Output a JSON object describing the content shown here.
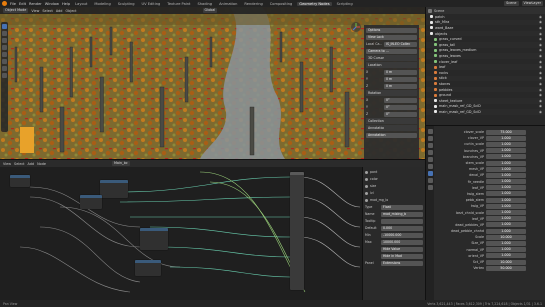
{
  "topbar": {
    "menus": [
      "File",
      "Edit",
      "Render",
      "Window",
      "Help"
    ],
    "workspaces": [
      "Layout",
      "Modeling",
      "Sculpting",
      "UV Editing",
      "Texture Paint",
      "Shading",
      "Animation",
      "Rendering",
      "Compositing",
      "Geometry Nodes",
      "Scripting"
    ],
    "active_workspace": "Geometry Nodes",
    "scene": "Scene",
    "view_layer": "ViewLayer"
  },
  "viewport": {
    "mode": "Object Mode",
    "menus": [
      "View",
      "Select",
      "Add",
      "Object"
    ],
    "transform": "Global",
    "npanel": {
      "rows": [
        {
          "label": "",
          "value": "Options"
        },
        {
          "label": "",
          "value": "View Lock"
        },
        {
          "label": "Local Ca…",
          "value": "IS_IN-EO Collec"
        },
        {
          "label": "",
          "value": "Camera to …"
        },
        {
          "label": "3D Cursor",
          "value": ""
        },
        {
          "label": "Location",
          "value": ""
        },
        {
          "label": "X",
          "value": "0 m"
        },
        {
          "label": "Y",
          "value": "0 m"
        },
        {
          "label": "Z",
          "value": "0 m"
        },
        {
          "label": "Rotation",
          "value": ""
        },
        {
          "label": "X",
          "value": "0°"
        },
        {
          "label": "Y",
          "value": "0°"
        },
        {
          "label": "Z",
          "value": "0°"
        },
        {
          "label": "Collections",
          "value": ""
        },
        {
          "label": "Annotations",
          "value": ""
        },
        {
          "label": "",
          "value": "Annotation"
        }
      ]
    }
  },
  "outliner": {
    "title": "Scene",
    "items": [
      {
        "name": "patch",
        "color": "#e8e8e8"
      },
      {
        "name": "sth_Mira",
        "color": "#e8e8e8"
      },
      {
        "name": "ward_Baze",
        "color": "#e8e8e8"
      },
      {
        "name": "objects",
        "color": "#e8e8e8"
      },
      {
        "name": "grass_curved",
        "color": "#83c37a"
      },
      {
        "name": "grass_tall",
        "color": "#83c37a"
      },
      {
        "name": "grass_leaves_medium",
        "color": "#83c37a"
      },
      {
        "name": "grass_leaves",
        "color": "#83c37a"
      },
      {
        "name": "clover_leaf",
        "color": "#83c37a"
      },
      {
        "name": "leaf",
        "color": "#d97b3b"
      },
      {
        "name": "rocks",
        "color": "#d97b3b"
      },
      {
        "name": "stick",
        "color": "#d97b3b"
      },
      {
        "name": "stones",
        "color": "#d97b3b"
      },
      {
        "name": "pebbles",
        "color": "#d97b3b"
      },
      {
        "name": "ground",
        "color": "#d97b3b"
      },
      {
        "name": "sheet_texture",
        "color": "#e8e8e8"
      },
      {
        "name": "main_mask_ref_GD_SciD",
        "color": "#e8e8e8"
      },
      {
        "name": "main_mask_ref_GD_SciD",
        "color": "#e8e8e8"
      }
    ]
  },
  "properties": {
    "rows": [
      {
        "label": "clover_scale",
        "value": "75.000"
      },
      {
        "label": "clover_VP",
        "value": "1.000"
      },
      {
        "label": "curtin_scale",
        "value": "1.000"
      },
      {
        "label": "bunches_VP",
        "value": "1.000"
      },
      {
        "label": "branches_VP",
        "value": "1.000"
      },
      {
        "label": "stem_scale",
        "value": "1.000"
      },
      {
        "label": "mesh_VP",
        "value": "1.000"
      },
      {
        "label": "decal_VP",
        "value": "1.000"
      },
      {
        "label": "fir_needle",
        "value": "1.000"
      },
      {
        "label": "leaf_VP",
        "value": "1.000"
      },
      {
        "label": "twig_stem",
        "value": "1.000"
      },
      {
        "label": "pebb_stem",
        "value": "1.000"
      },
      {
        "label": "twig_VP",
        "value": "1.000"
      },
      {
        "label": "bezt_chnld_scale",
        "value": "1.000"
      },
      {
        "label": "leaf_VP",
        "value": "1.000"
      },
      {
        "label": "dead_pebbles_VP",
        "value": "1.000"
      },
      {
        "label": "dead_pebble_chnhd",
        "value": "1.000"
      },
      {
        "label": "Scale",
        "value": "10.000"
      },
      {
        "label": "Size_VP",
        "value": "1.000"
      },
      {
        "label": "normal_VP",
        "value": "1.000"
      },
      {
        "label": "orient_VP",
        "value": "1.000"
      },
      {
        "label": "Sct_VP",
        "value": "10.000"
      },
      {
        "label": "Vertex",
        "value": "50.000"
      }
    ]
  },
  "node_editor": {
    "menus": [
      "View",
      "Select",
      "Add",
      "Node"
    ],
    "node_tree": "Main_bc",
    "sidebar": {
      "sockets": [
        "pont",
        "color",
        "size",
        "lvl",
        "mod_mg_lo"
      ],
      "rows": [
        {
          "label": "Type",
          "value": "Float"
        },
        {
          "label": "Name",
          "value": "mod_mixing_b"
        },
        {
          "label": "Tooltip",
          "value": ""
        },
        {
          "label": "Default",
          "value": "0.000"
        },
        {
          "label": "Min",
          "value": "-10000.000"
        },
        {
          "label": "Max",
          "value": "10000.000"
        },
        {
          "label": "",
          "value": "Hide Value"
        },
        {
          "label": "",
          "value": "Hide in Mod"
        }
      ],
      "panel": "Panel",
      "panel_value": "Extensions"
    }
  },
  "statusbar": {
    "left": "Pan View",
    "right": "Verts 3,621,443 | Faces 3,612,309 | Tris 7,224,618 | Objects 1/31 | 3.6.1"
  }
}
